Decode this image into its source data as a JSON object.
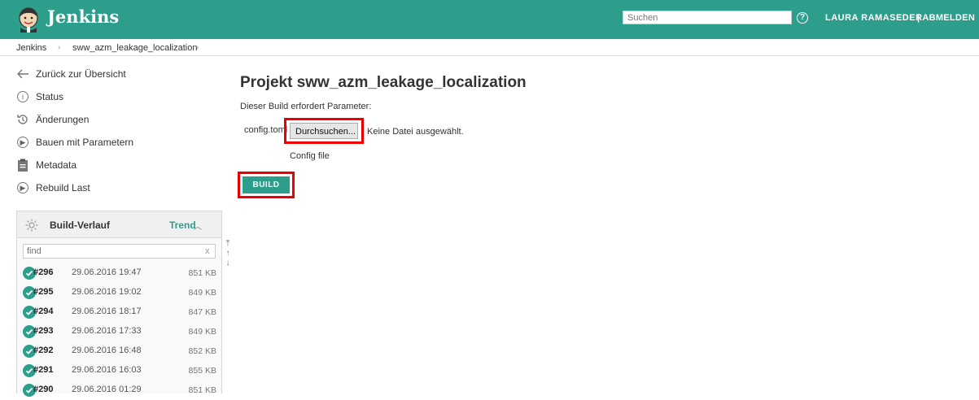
{
  "header": {
    "brand": "Jenkins",
    "search_placeholder": "Suchen",
    "help_icon": "?",
    "user": "LAURA RAMASEDER",
    "logout": "| ABMELDEN",
    "bg_color": "#2d9d8c"
  },
  "breadcrumb": {
    "items": [
      "Jenkins",
      "sww_azm_leakage_localization"
    ],
    "separator": "›"
  },
  "sidebar": {
    "items": [
      {
        "icon": "arrow-left-icon",
        "label": "Zurück zur Übersicht"
      },
      {
        "icon": "info-icon",
        "label": "Status"
      },
      {
        "icon": "history-icon",
        "label": "Änderungen"
      },
      {
        "icon": "play-icon",
        "label": "Bauen mit Parametern"
      },
      {
        "icon": "clipboard-icon",
        "label": "Metadata"
      },
      {
        "icon": "play-icon",
        "label": "Rebuild Last"
      }
    ]
  },
  "build_history": {
    "title": "Build-Verlauf",
    "trend_label": "Trend",
    "find_placeholder": "find",
    "clear": "x",
    "builds": [
      {
        "number": "#296",
        "date": "29.06.2016 19:47",
        "size": "851 KB"
      },
      {
        "number": "#295",
        "date": "29.06.2016 19:02",
        "size": "849 KB"
      },
      {
        "number": "#294",
        "date": "29.06.2016 18:17",
        "size": "847 KB"
      },
      {
        "number": "#293",
        "date": "29.06.2016 17:33",
        "size": "849 KB"
      },
      {
        "number": "#292",
        "date": "29.06.2016 16:48",
        "size": "852 KB"
      },
      {
        "number": "#291",
        "date": "29.06.2016 16:03",
        "size": "855 KB"
      },
      {
        "number": "#290",
        "date": "29.06.2016 01:29",
        "size": "851 KB"
      }
    ]
  },
  "main": {
    "title": "Projekt sww_azm_leakage_localization",
    "note": "Dieser Build erfordert Parameter:",
    "param_label": "config.toml",
    "browse_button": "Durchsuchen...",
    "no_file": "Keine Datei ausgewählt.",
    "param_description": "Config file",
    "build_button": "BUILD",
    "highlight_color": "#e00000"
  }
}
